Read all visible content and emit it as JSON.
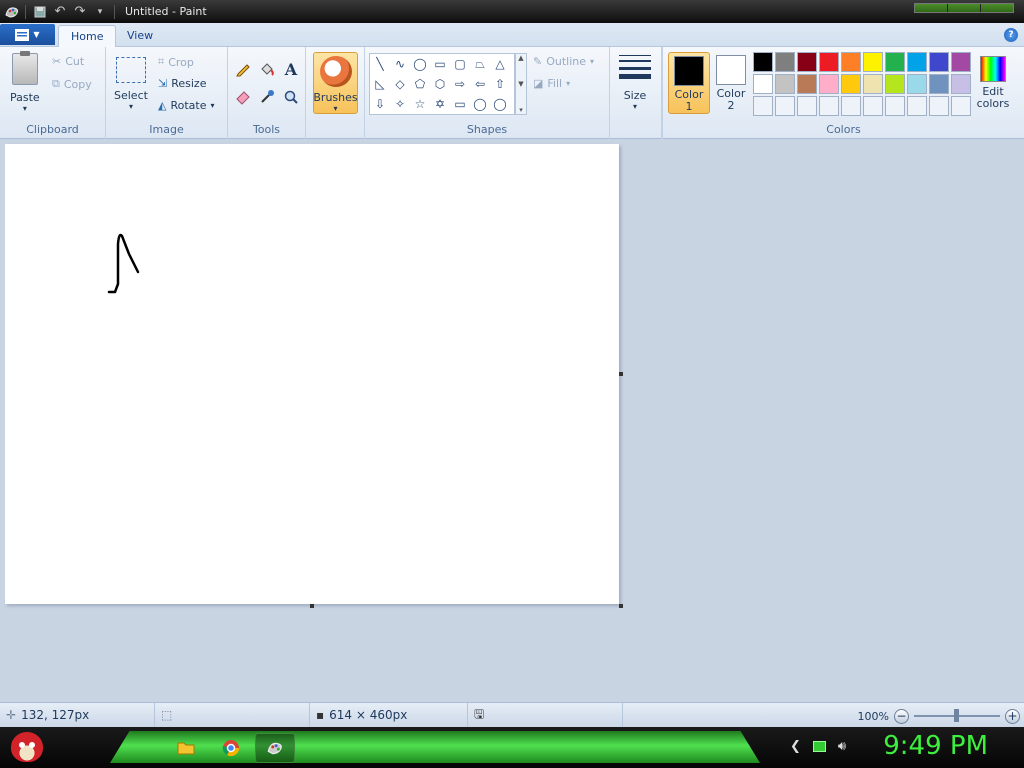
{
  "window": {
    "title": "Untitled - Paint"
  },
  "ribbon_tabs": [
    {
      "label": "Home",
      "active": true
    },
    {
      "label": "View",
      "active": false
    }
  ],
  "clipboard": {
    "group_label": "Clipboard",
    "paste": "Paste",
    "cut": "Cut",
    "copy": "Copy"
  },
  "image_group": {
    "group_label": "Image",
    "select": "Select",
    "crop": "Crop",
    "resize": "Resize",
    "rotate": "Rotate"
  },
  "tools": {
    "group_label": "Tools",
    "items": [
      "pencil-icon",
      "fill-icon",
      "text-icon",
      "eraser-icon",
      "color-picker-icon",
      "magnifier-icon"
    ]
  },
  "brushes": {
    "label": "Brushes"
  },
  "shapes": {
    "group_label": "Shapes",
    "outline": "Outline",
    "fill": "Fill",
    "glyphs": [
      "╲",
      "∿",
      "◯",
      "▭",
      "▢",
      "⏢",
      "△",
      "◺",
      "◇",
      "⬠",
      "⬡",
      "⇨",
      "⇦",
      "⇧",
      "⇩",
      "✧",
      "☆",
      "✡",
      "▭",
      "◯",
      "◯"
    ]
  },
  "size": {
    "label": "Size"
  },
  "colors": {
    "group_label": "Colors",
    "color1": "Color 1",
    "color2": "Color 2",
    "color1_value": "#000000",
    "color2_value": "#ffffff",
    "edit": "Edit colors",
    "palette": [
      "#000000",
      "#7f7f7f",
      "#880015",
      "#ed1c24",
      "#ff7f27",
      "#fff200",
      "#22b14c",
      "#00a2e8",
      "#3f48cc",
      "#a349a4",
      "#ffffff",
      "#c3c3c3",
      "#b97a57",
      "#ffaec9",
      "#ffc90e",
      "#efe4b0",
      "#b5e61d",
      "#99d9ea",
      "#7092be",
      "#c8bfe7",
      "#eef3fa",
      "#eef3fa",
      "#eef3fa",
      "#eef3fa",
      "#eef3fa",
      "#eef3fa",
      "#eef3fa",
      "#eef3fa",
      "#eef3fa",
      "#eef3fa"
    ]
  },
  "status": {
    "cursor_pos": "132, 127px",
    "canvas_size": "614 × 460px",
    "zoom": "100%"
  },
  "taskbar": {
    "clock": "9:49 PM",
    "items": [
      "folder-icon",
      "chrome-icon",
      "paint-icon"
    ]
  }
}
